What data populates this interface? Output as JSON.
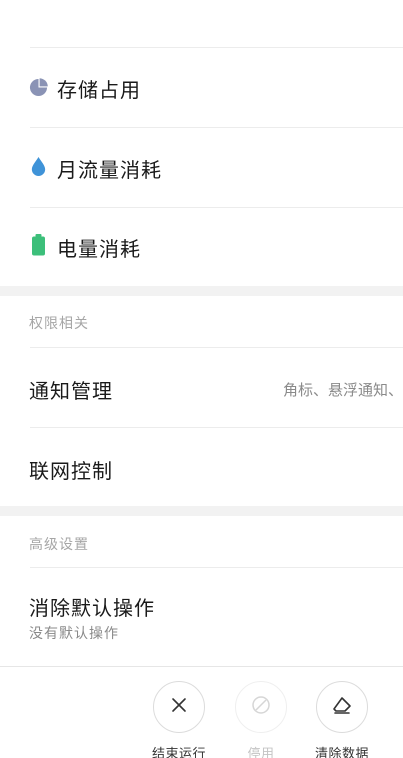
{
  "usage_items": [
    {
      "label": "存储占用",
      "icon": "pie-chart-icon",
      "color": "#8a93b5"
    },
    {
      "label": "月流量消耗",
      "icon": "water-drop-icon",
      "color": "#3f93d8"
    },
    {
      "label": "电量消耗",
      "icon": "battery-icon",
      "color": "#3cbf7a"
    }
  ],
  "permissions": {
    "header": "权限相关",
    "notification": {
      "label": "通知管理",
      "value": "角标、悬浮通知、"
    },
    "network": {
      "label": "联网控制"
    }
  },
  "advanced": {
    "header": "高级设置",
    "clear_defaults": {
      "label": "消除默认操作",
      "sub": "没有默认操作"
    }
  },
  "actions": {
    "force_stop": "结束运行",
    "disable": "停用",
    "clear_data": "清除数据"
  }
}
